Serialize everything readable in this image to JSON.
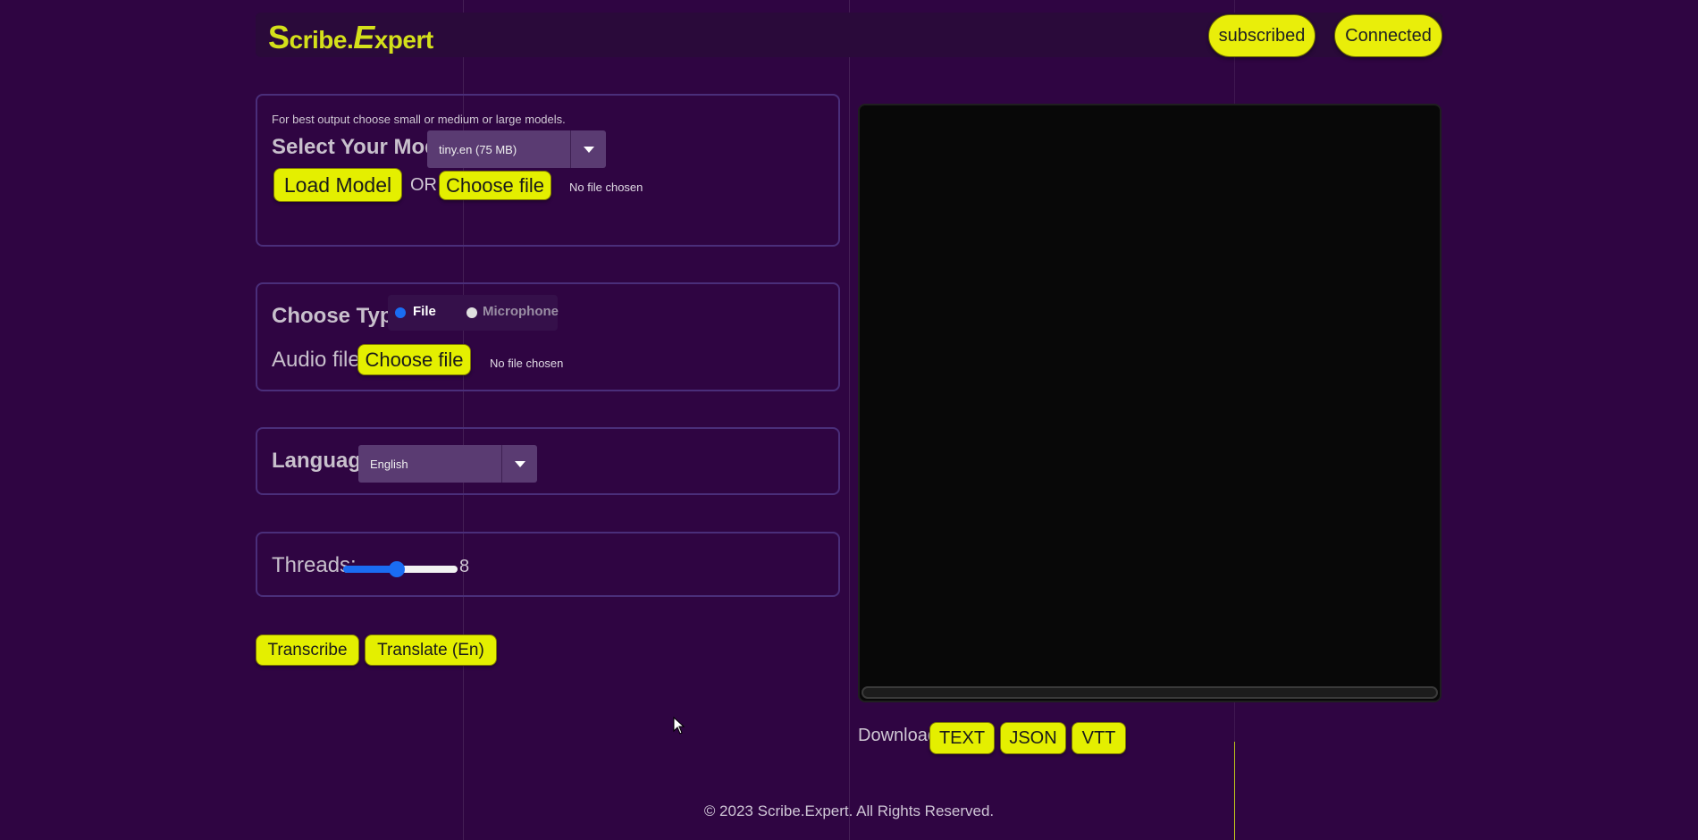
{
  "header": {
    "logo_s": "S",
    "logo_mid": "cribe.",
    "logo_e": "E",
    "logo_end": "xpert",
    "subscribed_label": "subscribed",
    "connected_label": "Connected"
  },
  "model_panel": {
    "note": "For best output choose small or medium or large models.",
    "select_label": "Select Your Model:",
    "selected_model": "tiny.en (75 MB)",
    "load_label": "Load Model",
    "or_label": "OR",
    "choose_file_label": "Choose file",
    "no_file_label": "No file chosen"
  },
  "type_panel": {
    "label": "Choose Type:",
    "options": [
      {
        "label": "File",
        "selected": true
      },
      {
        "label": "Microphone",
        "selected": false
      }
    ],
    "audio_label": "Audio file:",
    "choose_file_label": "Choose file",
    "no_file_label": "No file chosen"
  },
  "language_panel": {
    "label": "Language:",
    "selected": "English"
  },
  "threads_panel": {
    "label": "Threads:",
    "value": "8",
    "fraction": 0.47
  },
  "actions": {
    "transcribe_label": "Transcribe",
    "translate_label": "Translate (En)"
  },
  "download": {
    "label": "Download :",
    "text_label": "TEXT",
    "json_label": "JSON",
    "vtt_label": "VTT"
  },
  "footer": {
    "text": "© 2023 Scribe.Expert. All Rights Reserved."
  },
  "colors": {
    "background": "#2f0542",
    "accent": "#e4ef00",
    "logo": "#d4e01a",
    "radio_selected": "#1a6df2"
  },
  "icons": [
    "chevron-down-icon",
    "cursor-arrow-icon"
  ]
}
